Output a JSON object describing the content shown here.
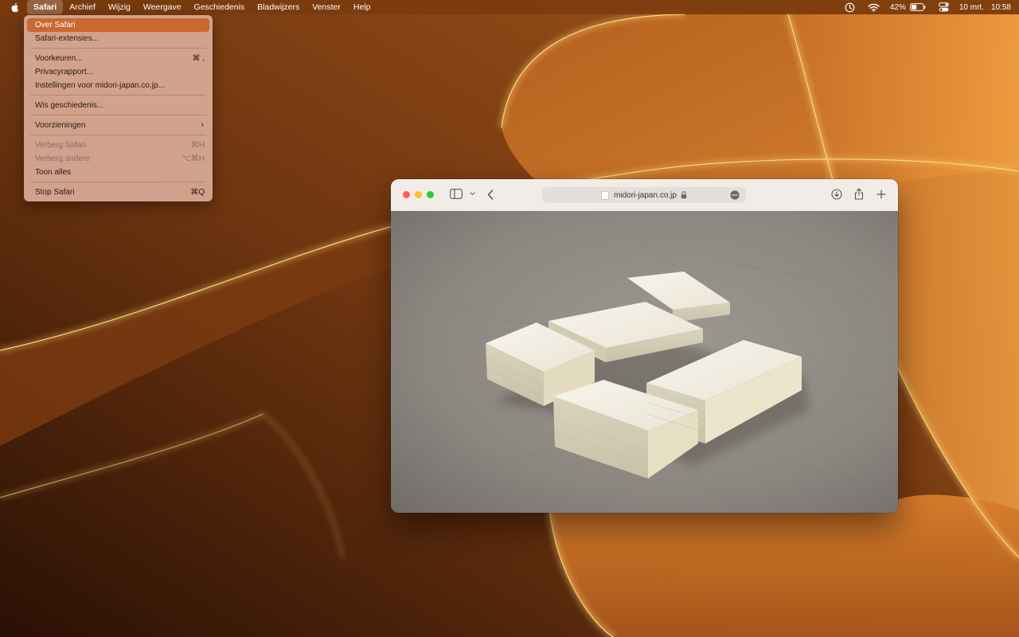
{
  "menubar": {
    "app_name": "Safari",
    "items": [
      "Archief",
      "Wijzig",
      "Weergave",
      "Geschiedenis",
      "Bladwijzers",
      "Venster",
      "Help"
    ],
    "status": {
      "battery": "42%",
      "date": "10 mrt.",
      "time": "10:58"
    },
    "icons": [
      "apple-logo-icon",
      "time-machine-icon",
      "wifi-icon",
      "battery-icon",
      "control-center-icon"
    ]
  },
  "safari_menu": {
    "about": "Over Safari",
    "extensions": "Safari-extensies...",
    "preferences": "Voorkeuren...",
    "preferences_sc": "⌘ ,",
    "privacy": "Privacyrapport...",
    "site_settings": "Instellingen voor midori-japan.co.jp...",
    "clear_history": "Wis geschiedenis...",
    "services": "Voorzieningen",
    "hide_safari": "Verberg Safari",
    "hide_safari_sc": "⌘H",
    "hide_others": "Verberg andere",
    "hide_others_sc": "⌥⌘H",
    "show_all": "Toon alles",
    "quit": "Stop Safari",
    "quit_sc": "⌘Q"
  },
  "browser": {
    "url": "midori-japan.co.jp",
    "icons": [
      "sidebar-icon",
      "chevron-down-icon",
      "back-icon",
      "lock-icon",
      "more-icon",
      "download-icon",
      "share-icon",
      "new-tab-icon"
    ]
  },
  "colors": {
    "menu_highlight": "#c9682f",
    "wallpaper_base": "#7a3d0f",
    "wallpaper_glow": "#ffcf6a"
  }
}
